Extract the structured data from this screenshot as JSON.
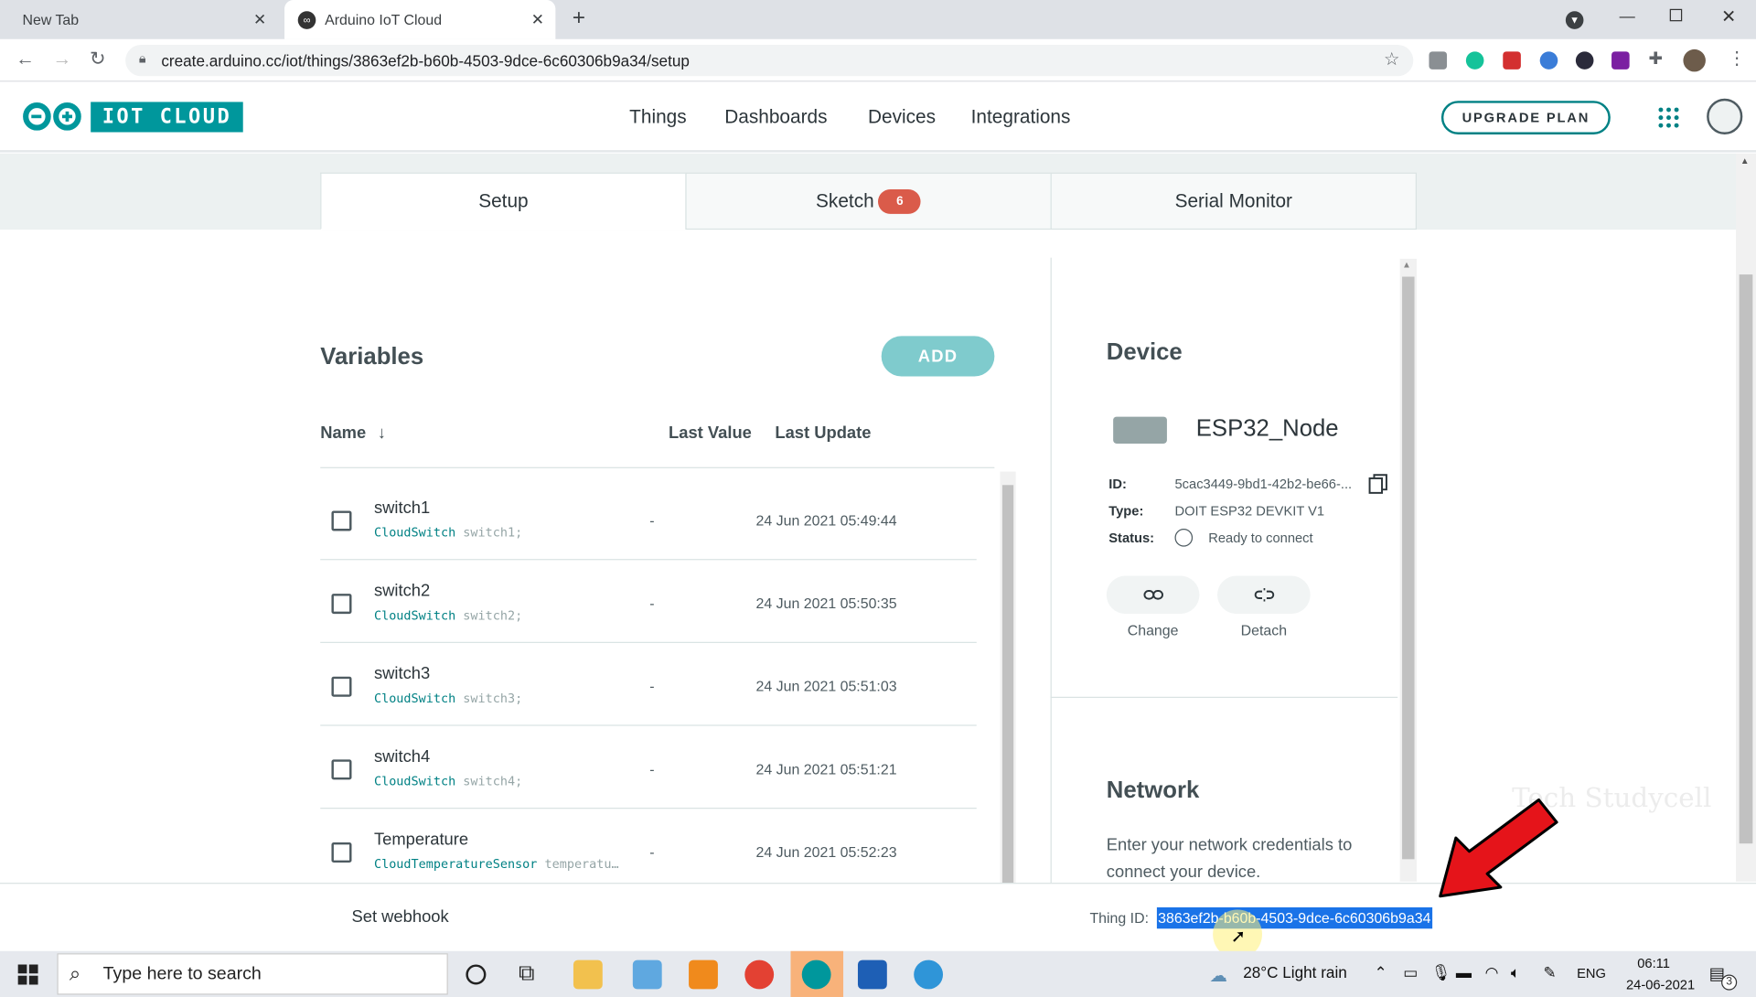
{
  "browser": {
    "tabs": [
      {
        "title": "New Tab",
        "active": false
      },
      {
        "title": "Arduino IoT Cloud",
        "active": true
      }
    ],
    "url": "create.arduino.cc/iot/things/3863ef2b-b60b-4503-9dce-6c60306b9a34/setup"
  },
  "app": {
    "logo_text": "IOT CLOUD",
    "nav": [
      "Things",
      "Dashboards",
      "Devices",
      "Integrations"
    ],
    "upgrade_label": "UPGRADE PLAN",
    "accent": "#00979c"
  },
  "tabs": {
    "setup": "Setup",
    "sketch": "Sketch",
    "sketch_badge": "6",
    "serial": "Serial Monitor"
  },
  "variables": {
    "title": "Variables",
    "add_label": "ADD",
    "columns": {
      "name": "Name",
      "last_value": "Last Value",
      "last_update": "Last Update"
    },
    "rows": [
      {
        "name": "switch1",
        "type": "CloudSwitch",
        "decl": "switch1;",
        "value": "-",
        "updated": "24 Jun 2021 05:49:44"
      },
      {
        "name": "switch2",
        "type": "CloudSwitch",
        "decl": "switch2;",
        "value": "-",
        "updated": "24 Jun 2021 05:50:35"
      },
      {
        "name": "switch3",
        "type": "CloudSwitch",
        "decl": "switch3;",
        "value": "-",
        "updated": "24 Jun 2021 05:51:03"
      },
      {
        "name": "switch4",
        "type": "CloudSwitch",
        "decl": "switch4;",
        "value": "-",
        "updated": "24 Jun 2021 05:51:21"
      },
      {
        "name": "Temperature",
        "type": "CloudTemperatureSensor",
        "decl": "temperatu…",
        "value": "-",
        "updated": "24 Jun 2021 05:52:23"
      }
    ]
  },
  "device": {
    "title": "Device",
    "name": "ESP32_Node",
    "id_label": "ID:",
    "id": "5cac3449-9bd1-42b2-be66-...",
    "type_label": "Type:",
    "type": "DOIT ESP32 DEVKIT V1",
    "status_label": "Status:",
    "status": "Ready to connect",
    "change_label": "Change",
    "detach_label": "Detach"
  },
  "network": {
    "title": "Network",
    "description": "Enter your network credentials to connect your device."
  },
  "footer": {
    "webhook": "Set webhook",
    "thing_id_label": "Thing ID:",
    "thing_id": "3863ef2b-b60b-4503-9dce-6c60306b9a34"
  },
  "watermark": "Tech Studycell",
  "taskbar": {
    "search_placeholder": "Type here to search",
    "weather": "28°C  Light rain",
    "lang": "ENG",
    "time": "06:11",
    "date": "24-06-2021",
    "notif_count": "3"
  }
}
